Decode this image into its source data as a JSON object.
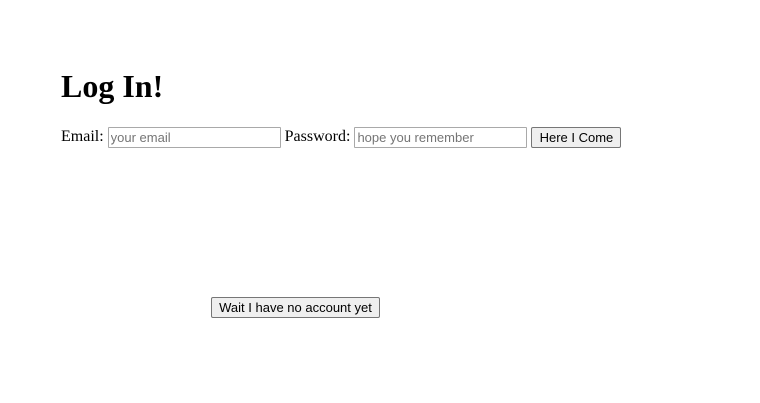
{
  "page": {
    "title": "Log In!"
  },
  "login_form": {
    "email_label": "Email:",
    "email_value": "",
    "email_placeholder": "your email",
    "password_label": "Password:",
    "password_value": "",
    "password_placeholder": "hope you remember",
    "submit_label": "Here I Come"
  },
  "signup": {
    "button_label": "Wait I have no account yet"
  }
}
